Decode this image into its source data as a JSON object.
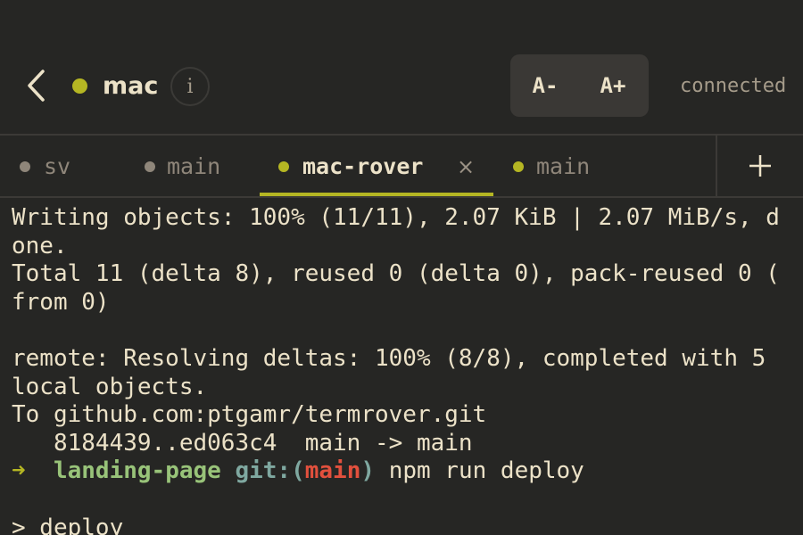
{
  "header": {
    "host_name": "mac",
    "info_label": "i",
    "font_decrease_label": "A-",
    "font_increase_label": "A+",
    "connection_status": "connected"
  },
  "tabs": [
    {
      "label": "sv",
      "dot_color": "#8f867a",
      "active": false
    },
    {
      "label": "main",
      "dot_color": "#8f867a",
      "active": false
    },
    {
      "label": "mac-rover",
      "dot_color": "#b5b623",
      "active": true,
      "close_label": "×"
    },
    {
      "label": "main",
      "dot_color": "#b5b623",
      "active": false
    }
  ],
  "terminal": {
    "lines": [
      "Writing objects: 100% (11/11), 2.07 KiB | 2.07 MiB/s, d",
      "one.",
      "Total 11 (delta 8), reused 0 (delta 0), pack-reused 0 (",
      "from 0)",
      "",
      "remote: Resolving deltas: 100% (8/8), completed with 5",
      "local objects.",
      "To github.com:ptgamr/termrover.git",
      "   8184439..ed063c4  main -> main"
    ],
    "prompt": {
      "arrow": "➜",
      "directory": "landing-page",
      "git_prefix": "git:(",
      "branch": "main",
      "git_suffix": ")",
      "command": "npm run deploy"
    },
    "after_lines": [
      "",
      "> deploy"
    ]
  },
  "colors": {
    "background": "#262624",
    "accent": "#b5b623",
    "text": "#ece2c8",
    "muted": "#8f867a",
    "prompt_dir": "#98c379",
    "prompt_git": "#7fa8a0",
    "prompt_branch": "#e2503d"
  },
  "icons": {
    "back": "chevron-left-icon",
    "status": "status-dot-icon",
    "info": "info-icon",
    "close_tab": "close-icon",
    "new_tab": "plus-icon"
  }
}
